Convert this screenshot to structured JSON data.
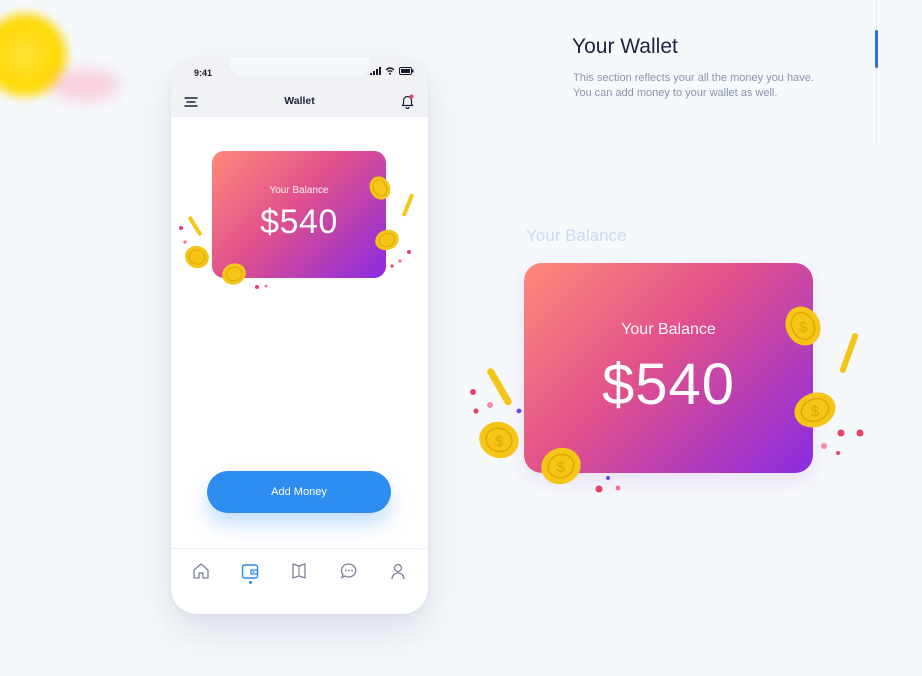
{
  "status_bar": {
    "time": "9:41"
  },
  "app_bar": {
    "title": "Wallet"
  },
  "balance_card": {
    "label": "Your Balance",
    "amount": "$540"
  },
  "actions": {
    "add_money_label": "Add Money"
  },
  "tabbar": {
    "items": [
      {
        "icon": "home-icon"
      },
      {
        "icon": "wallet-icon",
        "active": true
      },
      {
        "icon": "bookmark-icon"
      },
      {
        "icon": "chat-icon"
      },
      {
        "icon": "profile-icon"
      }
    ]
  },
  "showcase": {
    "title": "Your Wallet",
    "description_line1": "This section reflects your all the money you have.",
    "description_line2": "You can add money to your wallet as well.",
    "ghost_label": "Your Balance",
    "card_label": "Your Balance",
    "card_amount": "$540"
  },
  "colors": {
    "accent": "#2d8cf0",
    "gradient_start": "#ff8a7a",
    "gradient_mid": "#e0508c",
    "gradient_end": "#8a2be2",
    "coin": "#f5c518",
    "indicator": "#2f6cf2"
  }
}
